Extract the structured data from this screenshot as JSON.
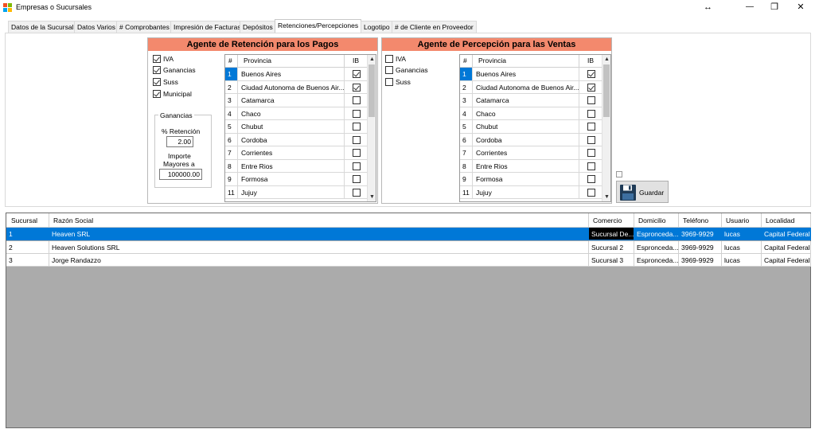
{
  "window": {
    "title": "Empresas o Sucursales",
    "resize_glyph": "↔",
    "minimize_glyph": "—",
    "restore_glyph": "❐",
    "close_glyph": "✕"
  },
  "tabs": [
    {
      "label": "Datos de la Sucursal"
    },
    {
      "label": "Datos Varios"
    },
    {
      "label": "# Comprobantes"
    },
    {
      "label": "Impresión de Facturas"
    },
    {
      "label": "Depósitos"
    },
    {
      "label": "Retenciones/Percepciones",
      "active": true
    },
    {
      "label": "Logotipo"
    },
    {
      "label": "# de Cliente en Proveedor"
    }
  ],
  "retencion": {
    "title": "Agente de Retención para los Pagos",
    "checks": [
      {
        "label": "IVA",
        "checked": true
      },
      {
        "label": "Ganancias",
        "checked": true
      },
      {
        "label": "Suss",
        "checked": true
      },
      {
        "label": "Municipal",
        "checked": true
      }
    ],
    "ganancias_group": "Ganancias",
    "pct_label": "% Retención",
    "pct_value": "2.00",
    "importe_label_1": "Importe",
    "importe_label_2": "Mayores a",
    "importe_value": "100000.00",
    "grid_headers": {
      "num": "#",
      "provincia": "Provincia",
      "ib": "IB"
    },
    "rows": [
      {
        "num": "1",
        "provincia": "Buenos Aires",
        "ib": true
      },
      {
        "num": "2",
        "provincia": "Ciudad Autonoma de Buenos Air...",
        "ib": true
      },
      {
        "num": "3",
        "provincia": "Catamarca",
        "ib": false
      },
      {
        "num": "4",
        "provincia": "Chaco",
        "ib": false
      },
      {
        "num": "5",
        "provincia": "Chubut",
        "ib": false
      },
      {
        "num": "6",
        "provincia": "Cordoba",
        "ib": false
      },
      {
        "num": "7",
        "provincia": "Corrientes",
        "ib": false
      },
      {
        "num": "8",
        "provincia": "Entre Rios",
        "ib": false
      },
      {
        "num": "9",
        "provincia": "Formosa",
        "ib": false
      },
      {
        "num": "11",
        "provincia": "Jujuy",
        "ib": false
      }
    ]
  },
  "percepcion": {
    "title": "Agente de Percepción para las Ventas",
    "checks": [
      {
        "label": "IVA",
        "checked": false
      },
      {
        "label": "Ganancias",
        "checked": false
      },
      {
        "label": "Suss",
        "checked": false
      }
    ],
    "grid_headers": {
      "num": "#",
      "provincia": "Provincia",
      "ib": "IB"
    },
    "rows": [
      {
        "num": "1",
        "provincia": "Buenos Aires",
        "ib": true
      },
      {
        "num": "2",
        "provincia": "Ciudad Autonoma de Buenos Air...",
        "ib": true
      },
      {
        "num": "3",
        "provincia": "Catamarca",
        "ib": false
      },
      {
        "num": "4",
        "provincia": "Chaco",
        "ib": false
      },
      {
        "num": "5",
        "provincia": "Chubut",
        "ib": false
      },
      {
        "num": "6",
        "provincia": "Cordoba",
        "ib": false
      },
      {
        "num": "7",
        "provincia": "Corrientes",
        "ib": false
      },
      {
        "num": "8",
        "provincia": "Entre Rios",
        "ib": false
      },
      {
        "num": "9",
        "provincia": "Formosa",
        "ib": false
      },
      {
        "num": "11",
        "provincia": "Jujuy",
        "ib": false
      }
    ]
  },
  "scroll_up_glyph": "▲",
  "scroll_down_glyph": "▼",
  "guardar": {
    "label": "Guardar",
    "icon": "floppy-disk-icon"
  },
  "sucursales": {
    "headers": [
      "Sucursal",
      "Razón Social",
      "Comercio",
      "Domicilio",
      "Teléfono",
      "Usuario",
      "Localidad"
    ],
    "rows": [
      [
        "1",
        "Heaven SRL",
        "Sucursal De...",
        "Espronceda...",
        "3969-9929",
        "lucas",
        "Capital Federal"
      ],
      [
        "2",
        "Heaven Solutions SRL",
        "Sucursal 2",
        "Espronceda...",
        "3969-9929",
        "lucas",
        "Capital Federal"
      ],
      [
        "3",
        "Jorge Randazzo",
        "Sucursal 3",
        "Espronceda...",
        "3969-9929",
        "lucas",
        "Capital Federal"
      ]
    ],
    "selected_row": 0
  },
  "colors": {
    "header_accent": "#f3896d",
    "selection": "#0078d7"
  }
}
